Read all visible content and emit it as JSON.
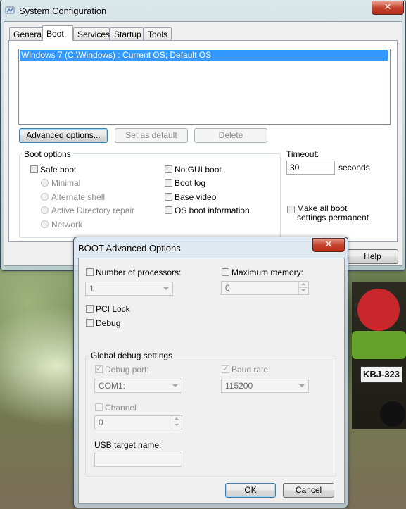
{
  "sysconfig": {
    "title": "System Configuration",
    "close_glyph": "✕",
    "tabs": [
      {
        "label": "General",
        "active": false
      },
      {
        "label": "Boot",
        "active": true
      },
      {
        "label": "Services",
        "active": false
      },
      {
        "label": "Startup",
        "active": false
      },
      {
        "label": "Tools",
        "active": false
      }
    ],
    "boot_entries": [
      "Windows 7 (C:\\Windows) : Current OS; Default OS"
    ],
    "buttons": {
      "advanced": "Advanced options...",
      "set_default": "Set as default",
      "delete": "Delete",
      "help": "Help"
    },
    "boot_options": {
      "legend": "Boot options",
      "safe_boot": "Safe boot",
      "minimal": "Minimal",
      "alternate_shell": "Alternate shell",
      "active_directory_repair": "Active Directory repair",
      "network": "Network",
      "no_gui_boot": "No GUI boot",
      "boot_log": "Boot log",
      "base_video": "Base video",
      "os_boot_information": "OS boot information"
    },
    "timeout": {
      "label": "Timeout:",
      "value": "30",
      "unit": "seconds"
    },
    "make_permanent": "Make all boot settings permanent"
  },
  "advanced_dialog": {
    "title": "BOOT Advanced Options",
    "close_glyph": "✕",
    "number_of_processors": {
      "label": "Number of processors:",
      "checked": false,
      "value": "1"
    },
    "maximum_memory": {
      "label": "Maximum memory:",
      "checked": false,
      "value": "0"
    },
    "pci_lock": {
      "label": "PCI Lock",
      "checked": false
    },
    "debug": {
      "label": "Debug",
      "checked": false
    },
    "global_debug": {
      "legend": "Global debug settings",
      "debug_port": {
        "label": "Debug port:",
        "checked": true,
        "value": "COM1:"
      },
      "baud_rate": {
        "label": "Baud rate:",
        "checked": true,
        "value": "115200"
      },
      "channel": {
        "label": "Channel",
        "checked": false,
        "value": "0"
      },
      "usb_target_name": {
        "label": "USB target name:",
        "value": ""
      }
    },
    "ok": "OK",
    "cancel": "Cancel"
  },
  "background": {
    "license_plate": "KBJ-323"
  }
}
